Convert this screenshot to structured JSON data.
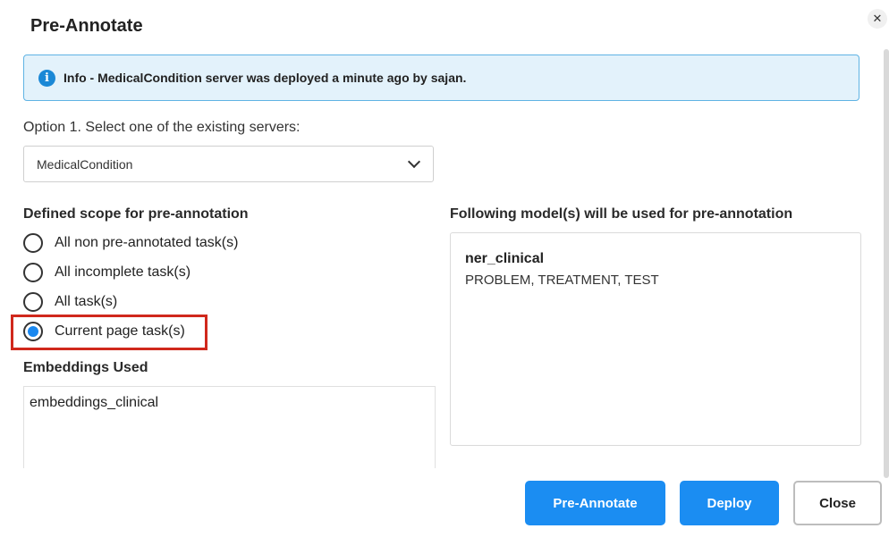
{
  "dialog": {
    "title": "Pre-Annotate",
    "close_icon": "close-icon"
  },
  "info": {
    "icon": "info-icon",
    "text": "Info - MedicalCondition server was deployed a minute ago by sajan."
  },
  "server": {
    "label": "Option 1. Select one of the existing servers:",
    "selected": "MedicalCondition"
  },
  "scope": {
    "label": "Defined scope for pre-annotation",
    "options": [
      {
        "label": "All non pre-annotated task(s)",
        "selected": false
      },
      {
        "label": "All incomplete task(s)",
        "selected": false
      },
      {
        "label": "All task(s)",
        "selected": false
      },
      {
        "label": "Current page task(s)",
        "selected": true
      }
    ]
  },
  "embeddings": {
    "label": "Embeddings Used",
    "value": "embeddings_clinical"
  },
  "models": {
    "label": "Following model(s) will be used for pre-annotation",
    "items": [
      {
        "name": "ner_clinical",
        "labels": "PROBLEM, TREATMENT, TEST"
      }
    ]
  },
  "buttons": {
    "pre_annotate": "Pre-Annotate",
    "deploy": "Deploy",
    "close": "Close"
  },
  "colors": {
    "primary": "#1b8df2",
    "info_bg": "#e3f2fb",
    "highlight": "#d0281c"
  }
}
